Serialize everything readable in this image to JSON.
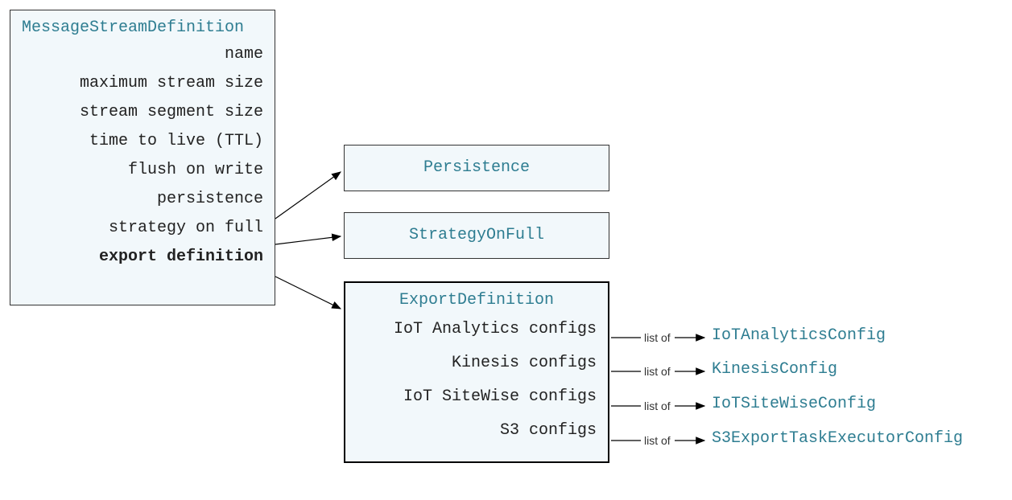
{
  "main": {
    "title": "MessageStreamDefinition",
    "props": [
      "name",
      "maximum stream size",
      "stream segment size",
      "time to live (TTL)",
      "flush on write",
      "persistence",
      "strategy on full",
      "export definition"
    ]
  },
  "persistence": {
    "label": "Persistence"
  },
  "strategy": {
    "label": "StrategyOnFull"
  },
  "export": {
    "title": "ExportDefinition",
    "props": [
      "IoT Analytics configs",
      "Kinesis configs",
      "IoT SiteWise configs",
      "S3 configs"
    ]
  },
  "list_of_label": "list of",
  "config_types": [
    "IoTAnalyticsConfig",
    "KinesisConfig",
    "IoTSiteWiseConfig",
    "S3ExportTaskExecutorConfig"
  ]
}
